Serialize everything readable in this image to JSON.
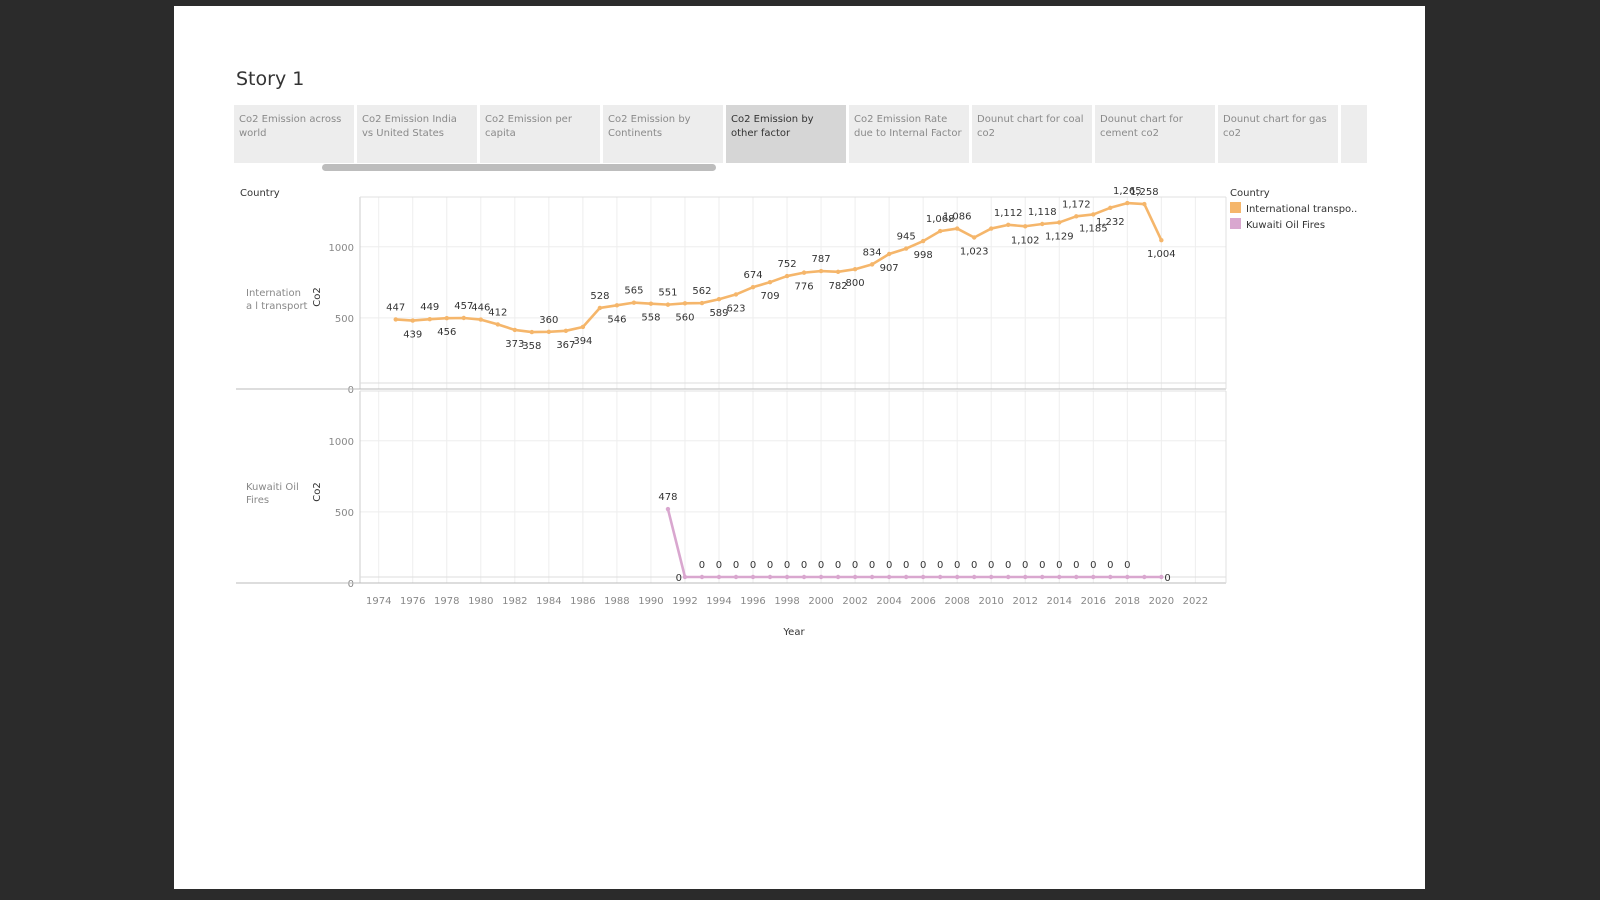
{
  "story": {
    "title": "Story 1",
    "tabs": [
      {
        "label": "Co2 Emission across world",
        "active": false
      },
      {
        "label": "Co2 Emission India vs United States",
        "active": false
      },
      {
        "label": "Co2 Emission per capita",
        "active": false
      },
      {
        "label": "Co2 Emission by Continents",
        "active": false
      },
      {
        "label": "Co2 Emission by other factor",
        "active": true
      },
      {
        "label": "Co2 Emission Rate due to Internal Factor",
        "active": false
      },
      {
        "label": "Dounut chart for coal co2",
        "active": false
      },
      {
        "label": "Dounut chart for cement co2",
        "active": false
      },
      {
        "label": "Dounut chart for gas co2",
        "active": false
      }
    ]
  },
  "chart_data": {
    "type": "line",
    "row_header": "Country",
    "xlabel": "Year",
    "ylabel": "Co2",
    "xlim": [
      1972.9,
      2023.8
    ],
    "ylim": [
      0,
      1350
    ],
    "x_ticks": [
      1974,
      1976,
      1978,
      1980,
      1982,
      1984,
      1986,
      1988,
      1990,
      1992,
      1994,
      1996,
      1998,
      2000,
      2002,
      2004,
      2006,
      2008,
      2010,
      2012,
      2014,
      2016,
      2018,
      2020,
      2022
    ],
    "y_ticks": [
      0,
      500,
      1000
    ],
    "legend": {
      "title": "Country",
      "position": "top-right"
    },
    "series": [
      {
        "name": "International transport",
        "row_label": "Internationa l transport",
        "legend_label": "International transpo..",
        "color": "#f5b66b",
        "x": [
          1975,
          1976,
          1977,
          1978,
          1979,
          1980,
          1981,
          1982,
          1983,
          1984,
          1985,
          1986,
          1987,
          1988,
          1989,
          1990,
          1991,
          1992,
          1993,
          1994,
          1995,
          1996,
          1997,
          1998,
          1999,
          2000,
          2001,
          2002,
          2003,
          2004,
          2005,
          2006,
          2007,
          2008,
          2009,
          2010,
          2011,
          2012,
          2013,
          2014,
          2015,
          2016,
          2017,
          2018,
          2019,
          2020
        ],
        "y": [
          447,
          439,
          449,
          456,
          457,
          446,
          412,
          373,
          358,
          360,
          367,
          394,
          528,
          546,
          565,
          558,
          551,
          560,
          562,
          589,
          623,
          674,
          709,
          752,
          776,
          787,
          782,
          800,
          834,
          907,
          945,
          998,
          1068,
          1086,
          1023,
          1086,
          1112,
          1102,
          1118,
          1129,
          1172,
          1185,
          1232,
          1265,
          1258,
          1004
        ],
        "labels": [
          "447",
          "439",
          "449",
          "456",
          "457",
          "446",
          "412",
          "373",
          "358",
          "360",
          "367",
          "394",
          "528",
          "546",
          "565",
          "558",
          "551",
          "560",
          "562",
          "589",
          "623",
          "674",
          "709",
          "752",
          "776",
          "787",
          "782",
          "800",
          "834",
          "907",
          "945",
          "998",
          "1,068",
          "1,086",
          "1,023",
          "1,086",
          "1,112",
          "1,102",
          "1,118",
          "1,129",
          "1,172",
          "1,185",
          "1,232",
          "1,265",
          "1,258",
          "1,004"
        ],
        "label_pos": [
          "a",
          "b",
          "a",
          "b",
          "a",
          "a",
          "a",
          "b",
          "b",
          "a",
          "b",
          "b",
          "a",
          "b",
          "a",
          "b",
          "a",
          "b",
          "a",
          "b",
          "b",
          "a",
          "b",
          "a",
          "b",
          "a",
          "b",
          "b",
          "a",
          "b",
          "a",
          "b",
          "a",
          "a",
          "b",
          "x",
          "a",
          "b",
          "a",
          "b",
          "a",
          "b",
          "b",
          "a",
          "a",
          "b"
        ]
      },
      {
        "name": "Kuwaiti Oil Fires",
        "row_label": "Kuwaiti Oil Fires",
        "legend_label": "Kuwaiti Oil Fires",
        "color": "#d9a7cf",
        "x": [
          1991,
          1992,
          1993,
          1994,
          1995,
          1996,
          1997,
          1998,
          1999,
          2000,
          2001,
          2002,
          2003,
          2004,
          2005,
          2006,
          2007,
          2008,
          2009,
          2010,
          2011,
          2012,
          2013,
          2014,
          2015,
          2016,
          2017,
          2018,
          2019,
          2020
        ],
        "y": [
          478,
          0,
          0,
          0,
          0,
          0,
          0,
          0,
          0,
          0,
          0,
          0,
          0,
          0,
          0,
          0,
          0,
          0,
          0,
          0,
          0,
          0,
          0,
          0,
          0,
          0,
          0,
          0,
          0,
          0
        ],
        "labels": [
          "478",
          "0",
          "0",
          "0",
          "0",
          "0",
          "0",
          "0",
          "0",
          "0",
          "0",
          "0",
          "0",
          "0",
          "0",
          "0",
          "0",
          "0",
          "0",
          "0",
          "0",
          "0",
          "0",
          "0",
          "0",
          "0",
          "0",
          "0",
          "0",
          "0"
        ],
        "label_pos": [
          "a",
          "l",
          "a",
          "a",
          "a",
          "a",
          "a",
          "a",
          "a",
          "a",
          "a",
          "a",
          "a",
          "a",
          "a",
          "a",
          "a",
          "a",
          "a",
          "a",
          "a",
          "a",
          "a",
          "a",
          "a",
          "a",
          "a",
          "a",
          "x",
          "r"
        ]
      }
    ]
  }
}
